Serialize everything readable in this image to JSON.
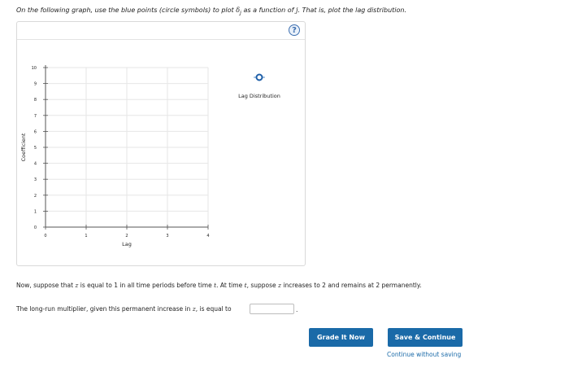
{
  "instruction": {
    "part1": "On the following graph, use the blue points (circle symbols) to plot ",
    "sym_delta": "δ",
    "sym_sub_j": "j",
    "part2": " as a function of ",
    "sym_j": "j",
    "part3": ". That is, plot the lag distribution."
  },
  "help_button": {
    "label": "?"
  },
  "chart_data": {
    "type": "scatter",
    "xlabel": "Lag",
    "ylabel": "Coefficient",
    "x_ticks": [
      "0",
      "1",
      "2",
      "3",
      "4"
    ],
    "y_ticks": [
      "0",
      "1",
      "2",
      "3",
      "4",
      "5",
      "6",
      "7",
      "8",
      "9",
      "10"
    ],
    "xlim": [
      0,
      4
    ],
    "ylim": [
      0,
      10
    ],
    "grid": true,
    "series": [
      {
        "name": "Lag Distribution",
        "marker": "circle",
        "color": "#1f5fa8",
        "points": []
      }
    ],
    "legend_placement": "top-right"
  },
  "paragraph1": {
    "part1": "Now, suppose that ",
    "z1": "z",
    "part2": " is equal to 1 in all time periods before time ",
    "t1": "t",
    "part3": ". At time ",
    "t2": "t",
    "part4": ", suppose ",
    "z2": "z",
    "part5": " increases to 2 and remains at 2 permanently."
  },
  "paragraph2": {
    "part1": "The long-run multiplier, given this permanent increase in ",
    "z": "z",
    "part2": ", is equal to",
    "period": "."
  },
  "answer_input": {
    "value": "",
    "placeholder": ""
  },
  "buttons": {
    "grade": "Grade It Now",
    "save": "Save & Continue"
  },
  "continue_link": "Continue without saving",
  "colors": {
    "accent": "#1a6aa8",
    "marker": "#1f5fa8"
  }
}
